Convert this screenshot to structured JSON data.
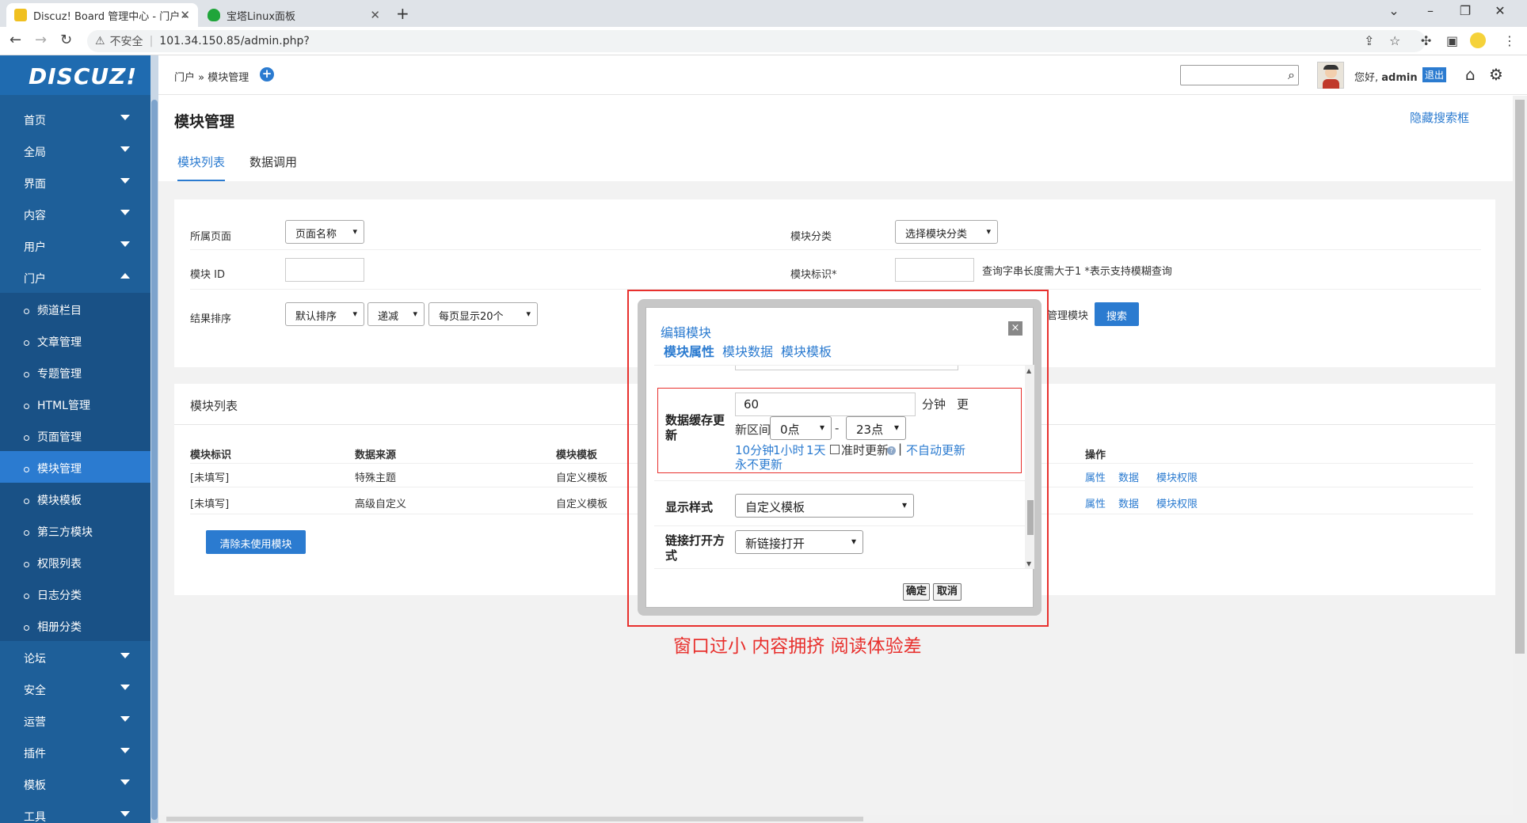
{
  "browser": {
    "tabs": [
      {
        "title": "Discuz! Board 管理中心 - 门户 -"
      },
      {
        "title": "宝塔Linux面板"
      }
    ],
    "new_tab": "+",
    "insecure_label": "不安全",
    "url": "101.34.150.85/admin.php?"
  },
  "sidebar": {
    "logo": "DISCUZ!",
    "top_items": [
      {
        "label": "首页"
      },
      {
        "label": "全局"
      },
      {
        "label": "界面"
      },
      {
        "label": "内容"
      },
      {
        "label": "用户"
      },
      {
        "label": "门户"
      }
    ],
    "sub_items": [
      {
        "label": "频道栏目"
      },
      {
        "label": "文章管理"
      },
      {
        "label": "专题管理"
      },
      {
        "label": "HTML管理"
      },
      {
        "label": "页面管理"
      },
      {
        "label": "模块管理"
      },
      {
        "label": "模块模板"
      },
      {
        "label": "第三方模块"
      },
      {
        "label": "权限列表"
      },
      {
        "label": "日志分类"
      },
      {
        "label": "相册分类"
      }
    ],
    "bottom_items": [
      {
        "label": "论坛"
      },
      {
        "label": "安全"
      },
      {
        "label": "运营"
      },
      {
        "label": "插件"
      },
      {
        "label": "模板"
      },
      {
        "label": "工具"
      }
    ]
  },
  "header": {
    "breadcrumb": "门户 » 模块管理",
    "add": "+",
    "greeting": "您好,",
    "username": "admin",
    "logout": "退出"
  },
  "page": {
    "title": "模块管理",
    "hide_search": "隐藏搜索框",
    "tabs": [
      {
        "label": "模块列表"
      },
      {
        "label": "数据调用"
      }
    ]
  },
  "filter": {
    "page_label": "所属页面",
    "page_select": "页面名称",
    "category_label": "模块分类",
    "category_select": "选择模块分类",
    "id_label": "模块 ID",
    "ident_label": "模块标识*",
    "ident_hint": "查询字串长度需大于1   *表示支持模糊查询",
    "sort_label": "结果排序",
    "sort_select": "默认排序",
    "order_select": "递减",
    "perpage_select": "每页显示20个",
    "manage_label": "管理模块",
    "search_button": "搜索"
  },
  "list": {
    "title": "模块列表",
    "columns": [
      "模块标识",
      "数据来源",
      "模块模板",
      "操作"
    ],
    "rows": [
      {
        "ident": "[未填写]",
        "source": "特殊主题",
        "template": "自定义模板",
        "actions": [
          "属性",
          "数据",
          "模块权限"
        ]
      },
      {
        "ident": "[未填写]",
        "source": "高级自定义",
        "template": "自定义模板",
        "actions": [
          "属性",
          "数据",
          "模块权限"
        ]
      }
    ],
    "clear_button": "清除未使用模块"
  },
  "modal": {
    "title": "编辑模块",
    "close": "×",
    "tabs": [
      {
        "label": "模块属性"
      },
      {
        "label": "模块数据"
      },
      {
        "label": "模块模板"
      }
    ],
    "cache_label": "数据缓存更新",
    "cache_value": "60",
    "cache_unit": "分钟",
    "cache_more": "更",
    "interval_label": "新区间",
    "interval_start": "0点",
    "interval_dash": "-",
    "interval_end": "23点",
    "quick_links": [
      "10分钟",
      "1小时",
      "1天"
    ],
    "ontime_label": "准时更新",
    "sep": "|",
    "no_auto": "不自动更新",
    "never": "永不更新",
    "style_label": "显示样式",
    "style_select": "自定义模板",
    "link_label": "链接打开方式",
    "link_select": "新链接打开",
    "ok": "确定",
    "cancel": "取消"
  },
  "annotation": "窗口过小 内容拥挤 阅读体验差",
  "colors": {
    "accent": "#2b7bd0",
    "sidebar": "#1e5f99",
    "annotation": "#e8302d"
  }
}
